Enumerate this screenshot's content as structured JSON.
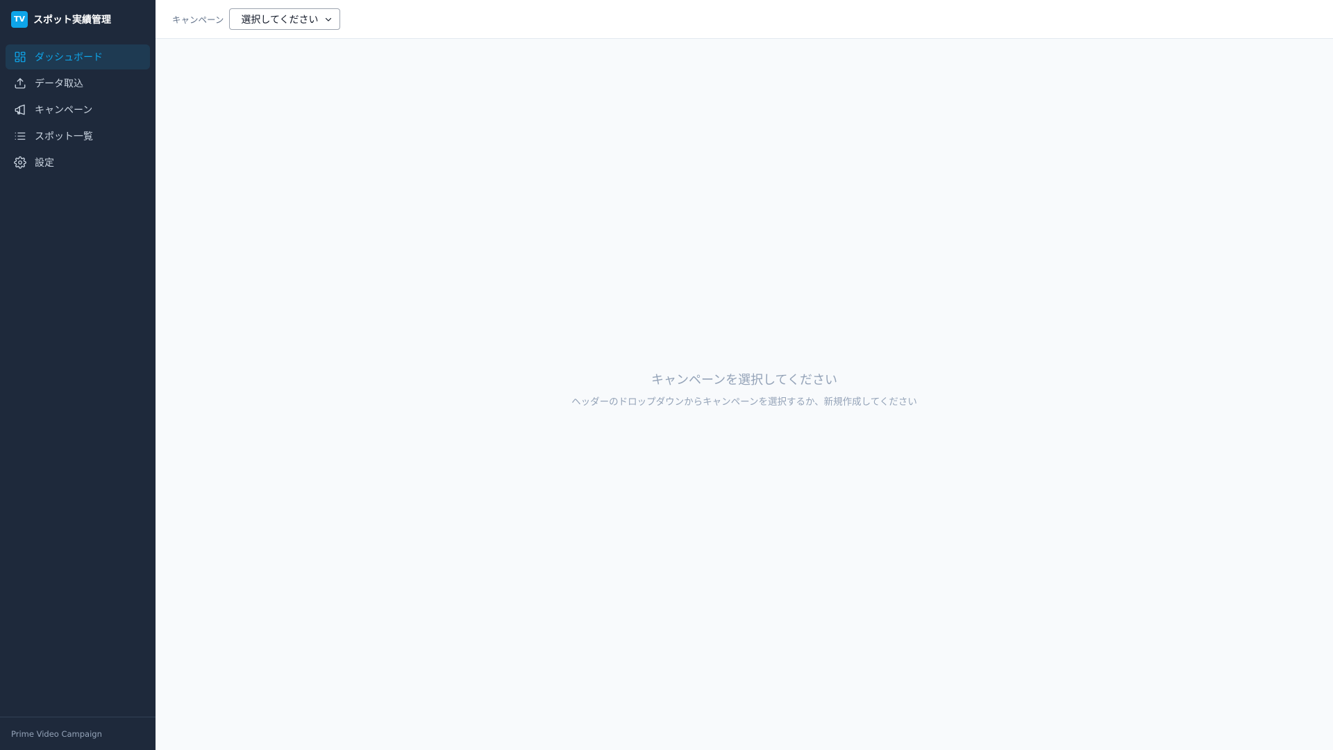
{
  "brand": {
    "logo_text": "TV",
    "title": "スポット実績管理"
  },
  "sidebar": {
    "items": [
      {
        "label": "ダッシュボード",
        "icon": "dashboard-icon",
        "active": true
      },
      {
        "label": "データ取込",
        "icon": "upload-icon",
        "active": false
      },
      {
        "label": "キャンペーン",
        "icon": "megaphone-icon",
        "active": false
      },
      {
        "label": "スポット一覧",
        "icon": "list-icon",
        "active": false
      },
      {
        "label": "設定",
        "icon": "gear-icon",
        "active": false
      }
    ],
    "footer": "Prime Video Campaign"
  },
  "header": {
    "campaign_label": "キャンペーン",
    "campaign_select": {
      "selected": "選択してください"
    }
  },
  "main": {
    "empty_title": "キャンペーンを選択してください",
    "empty_subtitle": "ヘッダーのドロップダウンからキャンペーンを選択するか、新規作成してください"
  },
  "colors": {
    "sidebar_bg": "#1e293b",
    "accent": "#0ea5e9",
    "active_bg": "#1e3a52",
    "content_bg": "#f8fafc"
  }
}
